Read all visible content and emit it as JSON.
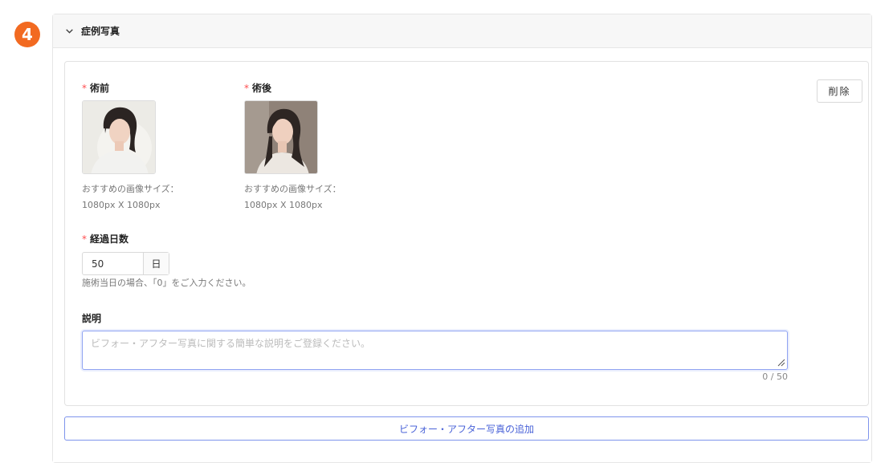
{
  "step_number": "4",
  "section": {
    "title": "症例写真"
  },
  "before": {
    "label": "術前",
    "required_mark": "*",
    "hint_line1": "おすすめの画像サイズ：",
    "hint_line2": "1080px X 1080px"
  },
  "after": {
    "label": "術後",
    "required_mark": "*",
    "hint_line1": "おすすめの画像サイズ：",
    "hint_line2": "1080px X 1080px"
  },
  "delete_label": "削除",
  "elapsed_days": {
    "label": "経過日数",
    "required_mark": "*",
    "value": "50",
    "unit": "日",
    "hint": "施術当日の場合、「0」をご入力ください。"
  },
  "description": {
    "label": "説明",
    "placeholder": "ビフォー・アフター写真に関する簡単な説明をご登録ください。",
    "counter": "0 / 50"
  },
  "add_button_label": "ビフォー・アフター写真の追加"
}
